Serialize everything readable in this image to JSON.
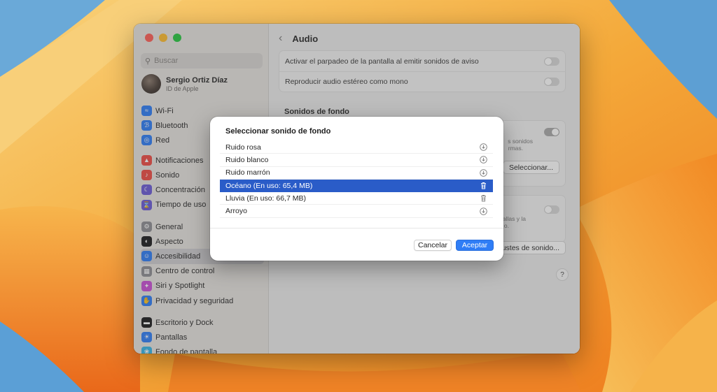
{
  "colors": {
    "accent": "#2f7df6",
    "selection": "#2a5cc8",
    "wallpaper_orange": "#f08a1f",
    "wallpaper_yellow": "#f7c45a"
  },
  "sidebar": {
    "search_placeholder": "Buscar",
    "account": {
      "name": "Sergio Ortiz Díaz",
      "subtitle": "ID de Apple"
    },
    "groups": [
      [
        {
          "label": "Wi-Fi",
          "icon": "wifi-icon",
          "color": "#2f7df6"
        },
        {
          "label": "Bluetooth",
          "icon": "bluetooth-icon",
          "color": "#2f7df6"
        },
        {
          "label": "Red",
          "icon": "globe-icon",
          "color": "#2f7df6"
        }
      ],
      [
        {
          "label": "Notificaciones",
          "icon": "bell-icon",
          "color": "#ef4b45"
        },
        {
          "label": "Sonido",
          "icon": "speaker-icon",
          "color": "#ef4b45"
        },
        {
          "label": "Concentración",
          "icon": "moon-icon",
          "color": "#6b5bd6"
        },
        {
          "label": "Tiempo de uso",
          "icon": "hourglass-icon",
          "color": "#6b5bd6"
        }
      ],
      [
        {
          "label": "General",
          "icon": "gear-icon",
          "color": "#8e8e93"
        },
        {
          "label": "Aspecto",
          "icon": "appearance-icon",
          "color": "#1c1c1e"
        },
        {
          "label": "Accesibilidad",
          "icon": "accessibility-icon",
          "color": "#2f7df6"
        },
        {
          "label": "Centro de control",
          "icon": "control-center-icon",
          "color": "#8e8e93"
        },
        {
          "label": "Siri y Spotlight",
          "icon": "siri-icon",
          "color": "#c94fd6"
        },
        {
          "label": "Privacidad y seguridad",
          "icon": "hand-icon",
          "color": "#2f7df6"
        }
      ],
      [
        {
          "label": "Escritorio y Dock",
          "icon": "dock-icon",
          "color": "#1c1c1e"
        },
        {
          "label": "Pantallas",
          "icon": "sun-icon",
          "color": "#2f7df6"
        },
        {
          "label": "Fondo de pantalla",
          "icon": "wallpaper-icon",
          "color": "#35b4e6"
        }
      ]
    ]
  },
  "main": {
    "title": "Audio",
    "rows": [
      {
        "label": "Activar el parpadeo de la pantalla al emitir sonidos de aviso"
      },
      {
        "label": "Reproducir audio estéreo como mono"
      }
    ],
    "section": "Sonidos de fondo",
    "faint_text_1": "s sonidos",
    "faint_text_2": "rmas.",
    "faint_text_3": "antallas y la",
    "faint_text_4": "o.",
    "select_button": "Seleccionar...",
    "adjust_button": "ustes de sonido...",
    "help": "?"
  },
  "dialog": {
    "title": "Seleccionar sonido de fondo",
    "items": [
      {
        "label": "Ruido rosa",
        "icon": "download-icon",
        "selected": false
      },
      {
        "label": "Ruido blanco",
        "icon": "download-icon",
        "selected": false
      },
      {
        "label": "Ruido marrón",
        "icon": "download-icon",
        "selected": false
      },
      {
        "label": "Océano (En uso: 65,4 MB)",
        "icon": "trash-icon",
        "selected": true
      },
      {
        "label": "Lluvia (En uso: 66,7 MB)",
        "icon": "trash-icon",
        "selected": false
      },
      {
        "label": "Arroyo",
        "icon": "download-icon",
        "selected": false
      }
    ],
    "cancel": "Cancelar",
    "accept": "Aceptar"
  }
}
